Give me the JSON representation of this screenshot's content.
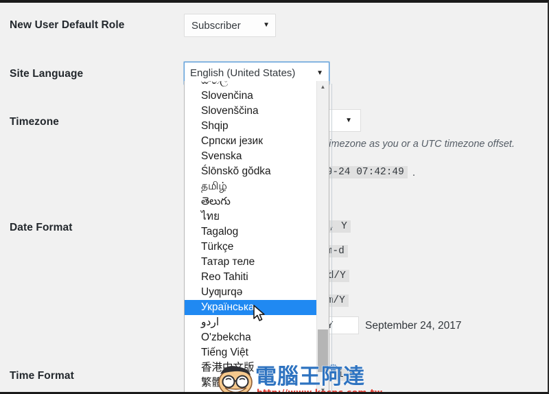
{
  "form": {
    "rows": [
      {
        "label": "New User Default Role"
      },
      {
        "label": "Site Language"
      },
      {
        "label": "Timezone"
      },
      {
        "label": "Date Format"
      },
      {
        "label": "Time Format"
      }
    ],
    "role_select": {
      "value": "Subscriber",
      "caret": "chevron-down-icon"
    },
    "language_select": {
      "value": "English (United States)",
      "caret": "chevron-down-icon"
    },
    "timezone_select": {
      "value": "",
      "caret": "chevron-down-icon"
    },
    "timezone_description": "ne timezone as you or a UTC timezone offset.",
    "timezone_current_time": "09-24 07:42:49",
    "timezone_time_suffix": ".",
    "date_format_options": [
      "j, Y",
      "-m-d",
      "/d/Y",
      "/m/Y"
    ],
    "date_format_custom_value": "j, Y",
    "date_format_custom_preview": "September 24, 2017",
    "time_format_option": "i a"
  },
  "language_listbox": {
    "clipped_first_item": "සිංහල",
    "options": [
      "Slovenčina",
      "Slovenščina",
      "Shqip",
      "Српски језик",
      "Svenska",
      "Ślōnskŏ gŏdka",
      "தமிழ்",
      "తెలుగు",
      "ไทย",
      "Tagalog",
      "Türkçe",
      "Татар теле",
      "Reo Tahiti",
      "Uyƣurqə",
      "Українська",
      "اردو",
      "O'zbekcha",
      "Tiếng Việt",
      "香港中文版",
      "繁體中文"
    ],
    "selected": "Українська",
    "selected_index": 14,
    "scrollbar": {
      "up_arrow": "triangle-up-icon",
      "down_arrow": "triangle-down-icon"
    }
  },
  "cursor": {
    "icon": "mouse-pointer-icon"
  },
  "watermark": {
    "text": "電腦王阿達",
    "url": "http://www.kocpc.com.tw",
    "crown": "crown-icon",
    "face": "mascot-face-icon"
  },
  "colors": {
    "page_background": "#f1f1f1",
    "selection_blue": "#2089f2",
    "focus_border": "#5b9dd9",
    "watermark_blue": "#2e73c0",
    "watermark_red": "#e03a2f"
  }
}
